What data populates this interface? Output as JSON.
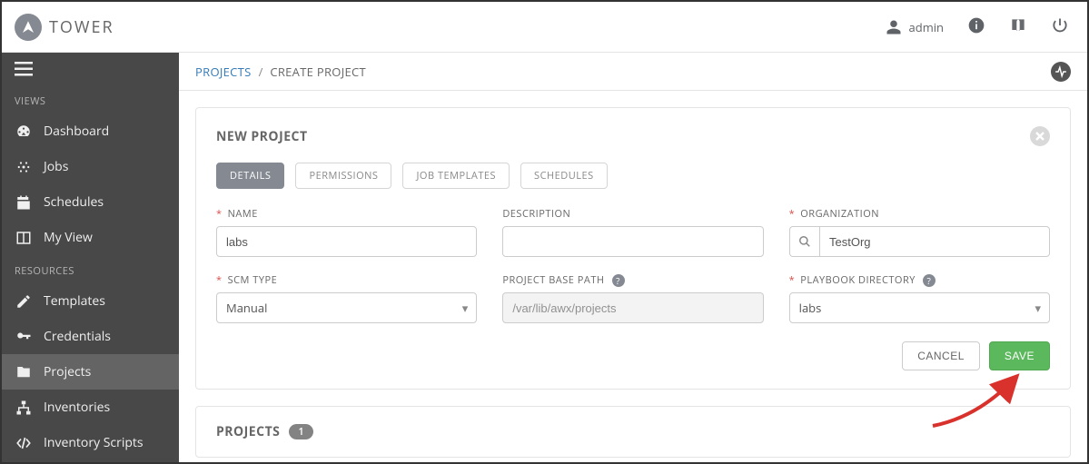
{
  "brand": {
    "name": "TOWER"
  },
  "user": {
    "name": "admin"
  },
  "sidebar": {
    "sections": {
      "views": {
        "label": "VIEWS",
        "items": [
          {
            "id": "dashboard",
            "label": "Dashboard"
          },
          {
            "id": "jobs",
            "label": "Jobs"
          },
          {
            "id": "schedules",
            "label": "Schedules"
          },
          {
            "id": "my-view",
            "label": "My View"
          }
        ]
      },
      "resources": {
        "label": "RESOURCES",
        "items": [
          {
            "id": "templates",
            "label": "Templates"
          },
          {
            "id": "credentials",
            "label": "Credentials"
          },
          {
            "id": "projects",
            "label": "Projects"
          },
          {
            "id": "inventories",
            "label": "Inventories"
          },
          {
            "id": "inventory-scripts",
            "label": "Inventory Scripts"
          }
        ]
      }
    },
    "active": "projects"
  },
  "breadcrumb": {
    "root": "PROJECTS",
    "current": "CREATE PROJECT"
  },
  "panel": {
    "title": "NEW PROJECT",
    "tabs": [
      {
        "id": "details",
        "label": "DETAILS",
        "active": true
      },
      {
        "id": "permissions",
        "label": "PERMISSIONS"
      },
      {
        "id": "job-templates",
        "label": "JOB TEMPLATES"
      },
      {
        "id": "schedules",
        "label": "SCHEDULES"
      }
    ],
    "fields": {
      "name": {
        "label": "NAME",
        "value": "labs",
        "required": true
      },
      "description": {
        "label": "DESCRIPTION",
        "value": "",
        "required": false
      },
      "organization": {
        "label": "ORGANIZATION",
        "value": "TestOrg",
        "required": true
      },
      "scm_type": {
        "label": "SCM TYPE",
        "value": "Manual",
        "required": true
      },
      "project_base_path": {
        "label": "PROJECT BASE PATH",
        "value": "/var/lib/awx/projects",
        "readonly": true,
        "help": true
      },
      "playbook_directory": {
        "label": "PLAYBOOK DIRECTORY",
        "value": "labs",
        "required": true,
        "help": true
      }
    },
    "actions": {
      "cancel": "CANCEL",
      "save": "SAVE"
    }
  },
  "list_panel": {
    "title": "PROJECTS",
    "count": "1"
  }
}
